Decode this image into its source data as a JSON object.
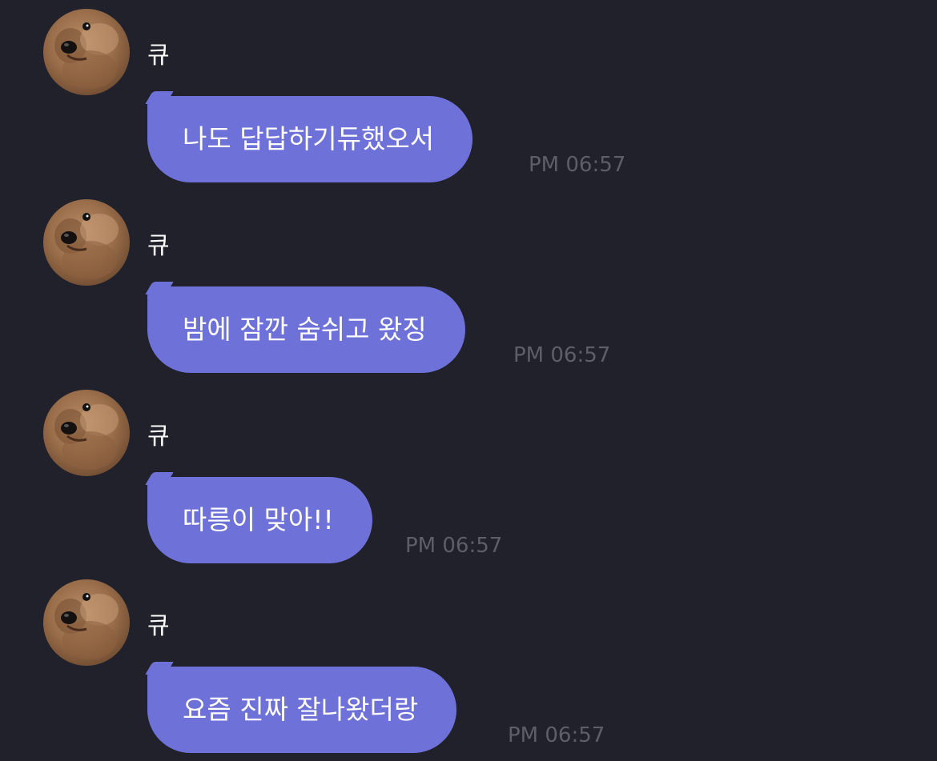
{
  "messages": [
    {
      "sender": "큐",
      "text": "나도 답답하기듀했오서",
      "time": "PM 06:57"
    },
    {
      "sender": "큐",
      "text": "밤에 잠깐 숨쉬고 왔징",
      "time": "PM 06:57"
    },
    {
      "sender": "큐",
      "text": "따릉이 맞아!!",
      "time": "PM 06:57"
    },
    {
      "sender": "큐",
      "text": "요즘 진짜 잘나왔더랑",
      "time": "PM 06:57"
    }
  ],
  "colors": {
    "background": "#21212b",
    "bubble": "#6e72d8",
    "time": "#5e5e6a",
    "text": "#ffffff"
  },
  "icons": {
    "avatar": "dog-avatar"
  }
}
